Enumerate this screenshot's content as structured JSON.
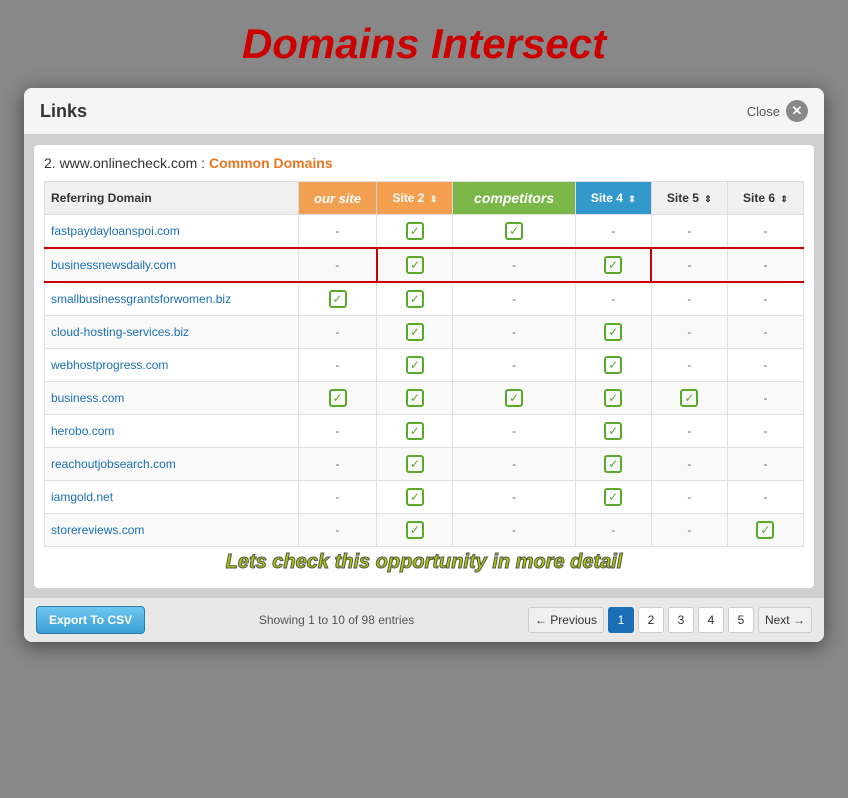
{
  "page": {
    "title": "Domains Intersect"
  },
  "modal": {
    "title": "Links",
    "close_label": "Close",
    "subtitle": "2. www.onlinecheck.com :",
    "site_label": "Common Domains",
    "opportunity_text": "Lets check this opportunity in more detail"
  },
  "table": {
    "columns": [
      {
        "id": "domain",
        "label": "Referring Domain"
      },
      {
        "id": "our_site",
        "label": "our site"
      },
      {
        "id": "site2",
        "label": "Site 2"
      },
      {
        "id": "competitors",
        "label": "competitors"
      },
      {
        "id": "site4",
        "label": "Site 4"
      },
      {
        "id": "site5",
        "label": "Site 5"
      },
      {
        "id": "site6",
        "label": "Site 6"
      }
    ],
    "rows": [
      {
        "domain": "fastpaydayloanspoi.com",
        "our_site": false,
        "site2": true,
        "competitors": true,
        "site4": false,
        "site5": false,
        "site6": false,
        "highlight": false
      },
      {
        "domain": "businessnewsdaily.com",
        "our_site": false,
        "site2": true,
        "competitors": false,
        "site4": true,
        "site5": false,
        "site6": false,
        "highlight": true
      },
      {
        "domain": "smallbusinessgrantsforwomen.biz",
        "our_site": true,
        "site2": true,
        "competitors": false,
        "site4": false,
        "site5": false,
        "site6": false,
        "highlight": false
      },
      {
        "domain": "cloud-hosting-services.biz",
        "our_site": false,
        "site2": true,
        "competitors": false,
        "site4": true,
        "site5": false,
        "site6": false,
        "highlight": false
      },
      {
        "domain": "webhostprogress.com",
        "our_site": false,
        "site2": true,
        "competitors": false,
        "site4": true,
        "site5": false,
        "site6": false,
        "highlight": false
      },
      {
        "domain": "business.com",
        "our_site": true,
        "site2": true,
        "competitors": true,
        "site4": true,
        "site5": true,
        "site6": false,
        "highlight": false
      },
      {
        "domain": "herobo.com",
        "our_site": false,
        "site2": true,
        "competitors": false,
        "site4": true,
        "site5": false,
        "site6": false,
        "highlight": false
      },
      {
        "domain": "reachoutjobsearch.com",
        "our_site": false,
        "site2": true,
        "competitors": false,
        "site4": true,
        "site5": false,
        "site6": false,
        "highlight": false
      },
      {
        "domain": "iamgold.net",
        "our_site": false,
        "site2": true,
        "competitors": false,
        "site4": true,
        "site5": false,
        "site6": false,
        "highlight": false
      },
      {
        "domain": "storereviews.com",
        "our_site": false,
        "site2": true,
        "competitors": false,
        "site4": false,
        "site5": false,
        "site6": true,
        "highlight": false
      }
    ]
  },
  "footer": {
    "export_label": "Export To CSV",
    "showing": "Showing 1 to 10 of 98 entries",
    "prev_label": "← Previous",
    "next_label": "Next →",
    "pages": [
      "1",
      "2",
      "3",
      "4",
      "5"
    ],
    "active_page": "1"
  }
}
